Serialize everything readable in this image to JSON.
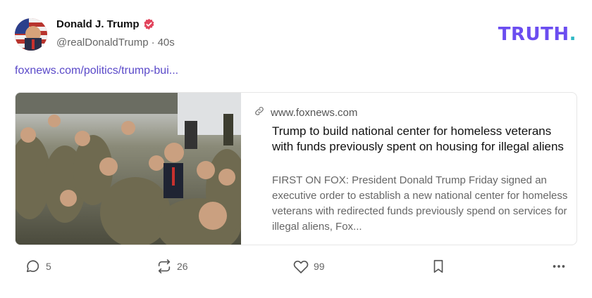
{
  "author": {
    "name": "Donald J. Trump",
    "handle": "@realDonaldTrump",
    "separator": "·",
    "time": "40s"
  },
  "brand": {
    "text": "TRUTH",
    "dot": "."
  },
  "post": {
    "link_text": "foxnews.com/politics/trump-bui..."
  },
  "card": {
    "domain": "www.foxnews.com",
    "title": "Trump to build national center for homeless veterans with funds previously spent on housing for illegal aliens",
    "description": "FIRST ON FOX: President Donald Trump Friday signed an executive order to establish a new national center for homeless veterans with redirected funds previously spend on services for illegal aliens, Fox..."
  },
  "actions": {
    "replies": "5",
    "retruths": "26",
    "likes": "99"
  },
  "colors": {
    "brand": "#6b4df0",
    "brand_dot": "#2fb8c4",
    "link": "#5a49c9",
    "verified": "#e2445c"
  },
  "icons": [
    "verified-badge-icon",
    "link-icon",
    "reply-icon",
    "retruth-icon",
    "like-icon",
    "bookmark-icon",
    "more-icon"
  ]
}
